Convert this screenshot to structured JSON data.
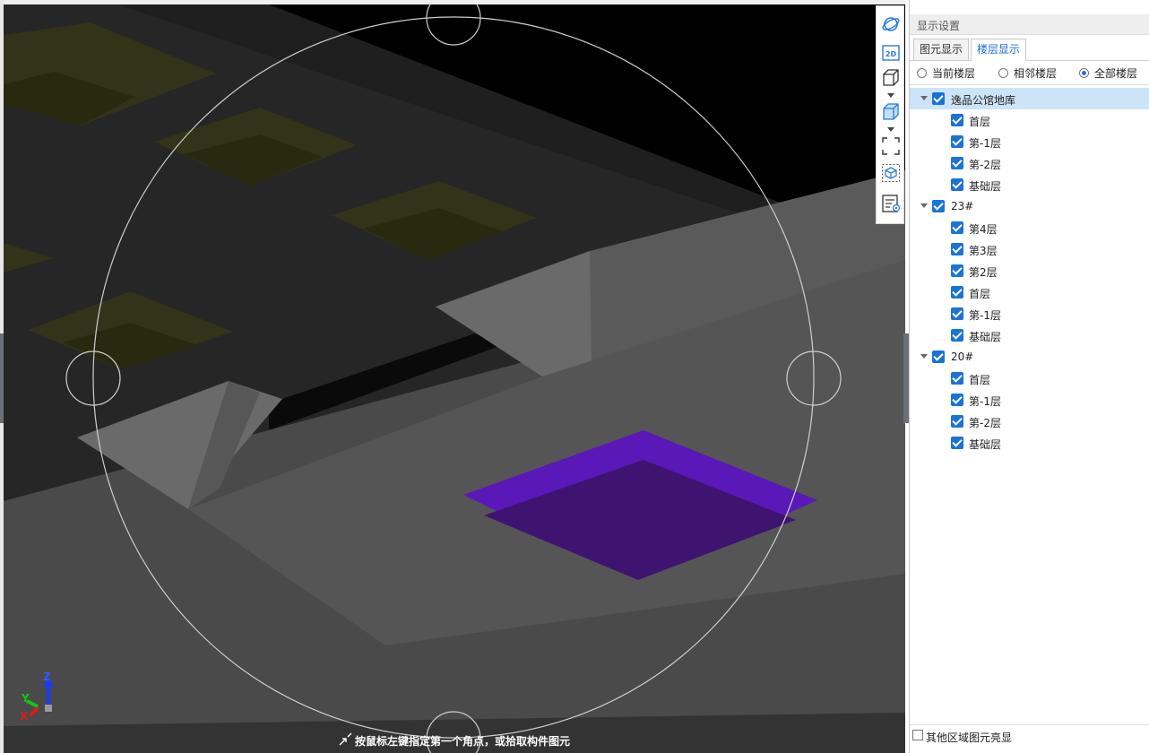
{
  "viewport": {
    "status_text": "按鼠标左键指定第一个角点，或拾取构件图元",
    "axis": {
      "z": "Z",
      "y": "Y",
      "x": "X"
    },
    "colors": {
      "background": "#3b3b3b",
      "purple_element": "#5a18b8",
      "olive_element": "#2e2e12",
      "slab": "#6a6a6a",
      "orbit_ring": "#cfcfcf"
    }
  },
  "toolbar": {
    "buttons": [
      {
        "name": "orbit",
        "icon": "orbit-icon"
      },
      {
        "name": "2d-view",
        "icon": "2d-view-icon",
        "label": "2D"
      },
      {
        "name": "3d-wireframe",
        "icon": "cube-wireframe-icon"
      },
      {
        "name": "3d-shaded",
        "icon": "cube-shaded-icon"
      },
      {
        "name": "zoom-extents",
        "icon": "fit-frame-icon"
      },
      {
        "name": "local-3d",
        "icon": "local-cube-icon"
      },
      {
        "name": "display-settings",
        "icon": "display-settings-icon"
      }
    ]
  },
  "panel": {
    "title": "显示设置",
    "tabs": [
      {
        "label": "图元显示",
        "active": false
      },
      {
        "label": "楼层显示",
        "active": true
      }
    ],
    "radio_options": [
      {
        "label": "当前楼层",
        "selected": false
      },
      {
        "label": "相邻楼层",
        "selected": false
      },
      {
        "label": "全部楼层",
        "selected": true
      }
    ],
    "tree": [
      {
        "label": "逸品公馆地库",
        "checked": true,
        "children": [
          "首层",
          "第-1层",
          "第-2层",
          "基础层"
        ]
      },
      {
        "label": "23#",
        "checked": true,
        "children": [
          "第4层",
          "第3层",
          "第2层",
          "首层",
          "第-1层",
          "基础层"
        ]
      },
      {
        "label": "20#",
        "checked": true,
        "children": [
          "首层",
          "第-1层",
          "第-2层",
          "基础层"
        ]
      }
    ],
    "footer_checkbox": {
      "label": "其他区域图元亮显",
      "checked": false
    }
  }
}
